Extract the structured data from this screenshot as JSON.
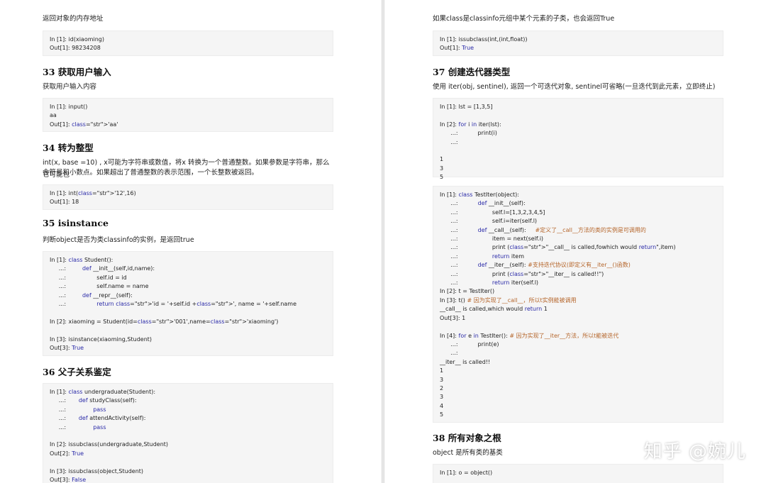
{
  "left": {
    "intro": "返回对象的内存地址",
    "code_id": [
      "In [1]: id(xiaoming)",
      "Out[1]: 98234208"
    ],
    "s33": {
      "title": "33 获取用户输入",
      "desc": "获取用户输入内容",
      "code": [
        "In [1]: input()",
        "aa",
        "Out[1]: 'aa'"
      ]
    },
    "s34": {
      "title": "34 转为整型",
      "desc1": "int(x, base =10) , x可能为字符串或数值，将x 转换为一个普通整数。如果参数是字符串，那么它可能包",
      "desc2": "含符号和小数点。如果超出了普通整数的表示范围，一个长整数被返回。",
      "code": [
        "In [1]: int('12',16)",
        "Out[1]: 18"
      ]
    },
    "s35": {
      "title": "35 isinstance",
      "desc": "判断object是否为类classinfo的实例，是返回true",
      "code": [
        "In [1]: class Student():",
        "     ...:         def __init__(self,id,name):",
        "     ...:                 self.id = id",
        "     ...:                 self.name = name",
        "     ...:         def __repr__(self):",
        "     ...:                 return 'id = '+self.id +', name = '+self.name",
        "",
        "In [2]: xiaoming = Student(id='001',name='xiaoming')",
        "",
        "In [3]: isinstance(xiaoming,Student)",
        "Out[3]: True"
      ]
    },
    "s36": {
      "title": "36 父子关系鉴定",
      "code": [
        "In [1]: class undergraduate(Student):",
        "     ...:       def studyClass(self):",
        "     ...:               pass",
        "     ...:       def attendActivity(self):",
        "     ...:               pass",
        "",
        "In [2]: issubclass(undergraduate,Student)",
        "Out[2]: True",
        "",
        "In [3]: issubclass(object,Student)",
        "Out[3]: False"
      ]
    }
  },
  "right": {
    "intro": "如果class是classinfo元组中某个元素的子类，也会返回True",
    "code_sub": [
      "In [1]: issubclass(int,(int,float))",
      "Out[1]: True"
    ],
    "s37": {
      "title": "37 创建迭代器类型",
      "desc": "使用 iter(obj, sentinel), 返回一个可迭代对象, sentinel可省略(一旦迭代到此元素，立即终止)",
      "code1": [
        "In [1]: lst = [1,3,5]",
        "",
        "In [2]: for i in iter(lst):",
        "      ...:           print(i)",
        "      ...:",
        "",
        "1",
        "3",
        "5"
      ],
      "code2": [
        "In [1]: class TestIter(object):",
        "      ...:           def __init__(self):",
        "      ...:                   self.l=[1,3,2,3,4,5]",
        "      ...:                   self.i=iter(self.l)",
        "      ...:           def __call__(self):     #定义了__call__方法的类的实例是可调用的",
        "      ...:                   item = next(self.i)",
        "      ...:                   print (\"__call__ is called,fowhich would return\",item)",
        "      ...:                   return item",
        "      ...:           def __iter__(self): #支持迭代协议(即定义有__iter__()函数)",
        "      ...:                   print (\"__iter__ is called!!\")",
        "      ...:                   return iter(self.l)",
        "In [2]: t = TestIter()",
        "In [3]: t() # 因为实现了__call__，所以t实例能被调用",
        "__call__ is called,which would return 1",
        "Out[3]: 1",
        "",
        "In [4]: for e in TestIter(): # 因为实现了__iter__方法，所以t能被迭代",
        "      ...:           print(e)",
        "      ...:",
        "__iter__ is called!!",
        "1",
        "3",
        "2",
        "3",
        "4",
        "5"
      ]
    },
    "s38": {
      "title": "38 所有对象之根",
      "desc": "object 是所有类的基类",
      "code": [
        "In [1]: o = object()"
      ]
    }
  },
  "watermark": "知乎 @婉儿"
}
